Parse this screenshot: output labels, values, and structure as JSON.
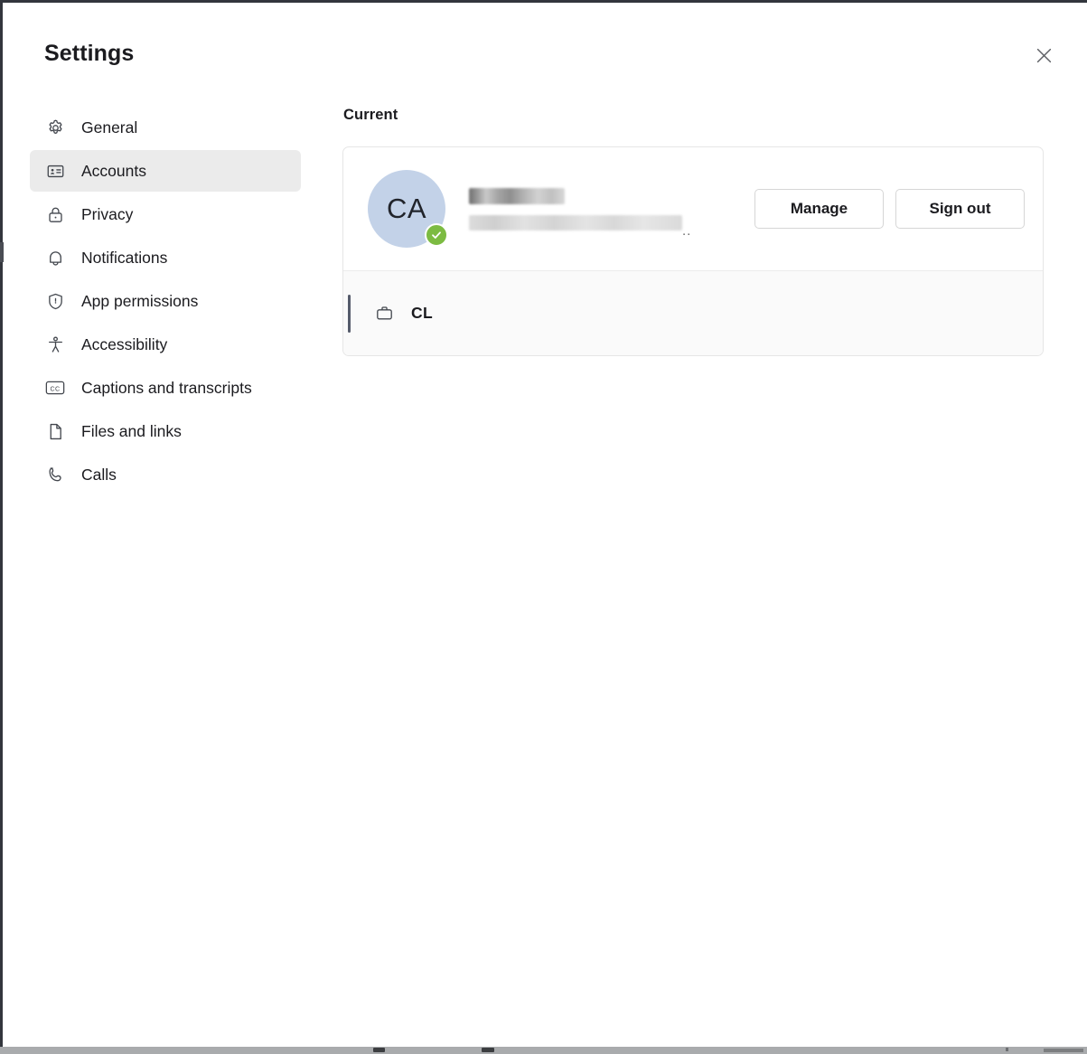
{
  "window": {
    "title": "Settings",
    "close_label": "Close",
    "close_icon": "close-icon"
  },
  "sidebar": {
    "items": [
      {
        "label": "General",
        "icon": "gear-icon",
        "selected": false
      },
      {
        "label": "Accounts",
        "icon": "contact-card-icon",
        "selected": true
      },
      {
        "label": "Privacy",
        "icon": "lock-icon",
        "selected": false
      },
      {
        "label": "Notifications",
        "icon": "bell-icon",
        "selected": false
      },
      {
        "label": "App permissions",
        "icon": "shield-icon",
        "selected": false
      },
      {
        "label": "Accessibility",
        "icon": "accessibility-icon",
        "selected": false
      },
      {
        "label": "Captions and transcripts",
        "icon": "closed-caption-icon",
        "selected": false
      },
      {
        "label": "Files and links",
        "icon": "document-icon",
        "selected": false
      },
      {
        "label": "Calls",
        "icon": "phone-icon",
        "selected": false
      }
    ]
  },
  "main": {
    "section_heading": "Current",
    "current_account": {
      "avatar_initials": "CA",
      "presence_status": "available",
      "presence_icon": "checkmark-icon",
      "display_name": "",
      "display_name_redacted": true,
      "email": "",
      "email_redacted": true,
      "email_truncation": "..",
      "manage_label": "Manage",
      "signout_label": "Sign out"
    },
    "org_row": {
      "name": "CL",
      "icon": "briefcase-icon",
      "selected": true
    }
  },
  "colors": {
    "accent_bar": "#555b6b",
    "avatar_background": "#c3d2e8",
    "presence_green": "#7cbb42",
    "selected_nav_background": "#ebebeb",
    "card_border": "#e6e6e6",
    "org_row_background": "#fafafa",
    "text_primary": "#1b1b1f",
    "icon_stroke": "#42464d",
    "window_edge": "#33363d"
  }
}
